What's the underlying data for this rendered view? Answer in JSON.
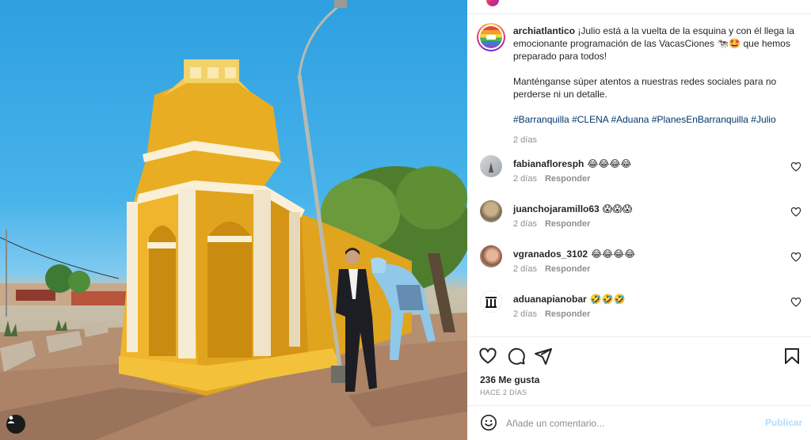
{
  "post": {
    "author": "archiatlantico",
    "caption_line1": "¡Julio está a la vuelta de la esquina y con él llega la emocionante programación de las VacasCiones 🐄🤩 que hemos preparado para todos!",
    "caption_line2": "Manténganse súper atentos a nuestras redes sociales para no perderse ni un detalle.",
    "hashtags": [
      "#Barranquilla",
      "#CLENA",
      "#Aduana",
      "#PlanesEnBarranquilla",
      "#Julio"
    ],
    "time": "2 días"
  },
  "comments": [
    {
      "user": "fabianafloresph",
      "text": "😂😂😂😂",
      "time": "2 días",
      "reply": "Responder"
    },
    {
      "user": "juanchojaramillo63",
      "text": "😱😱😱",
      "time": "2 días",
      "reply": "Responder"
    },
    {
      "user": "vgranados_3102",
      "text": "😂😂😂😂",
      "time": "2 días",
      "reply": "Responder"
    },
    {
      "user": "aduanapianobar",
      "text": "🤣🤣🤣",
      "time": "2 días",
      "reply": "Responder"
    }
  ],
  "stats": {
    "likes": "236 Me gusta",
    "ago": "HACE 2 DÍAS"
  },
  "composer": {
    "placeholder": "Añade un comentario...",
    "post_label": "Publicar"
  },
  "colors": {
    "hashtag": "#00376b",
    "muted": "#8e8e8e",
    "post_disabled": "#b3dbff"
  },
  "icons": [
    "heart-icon",
    "comment-icon",
    "share-icon",
    "bookmark-icon",
    "emoji-icon",
    "user-tag-icon"
  ]
}
